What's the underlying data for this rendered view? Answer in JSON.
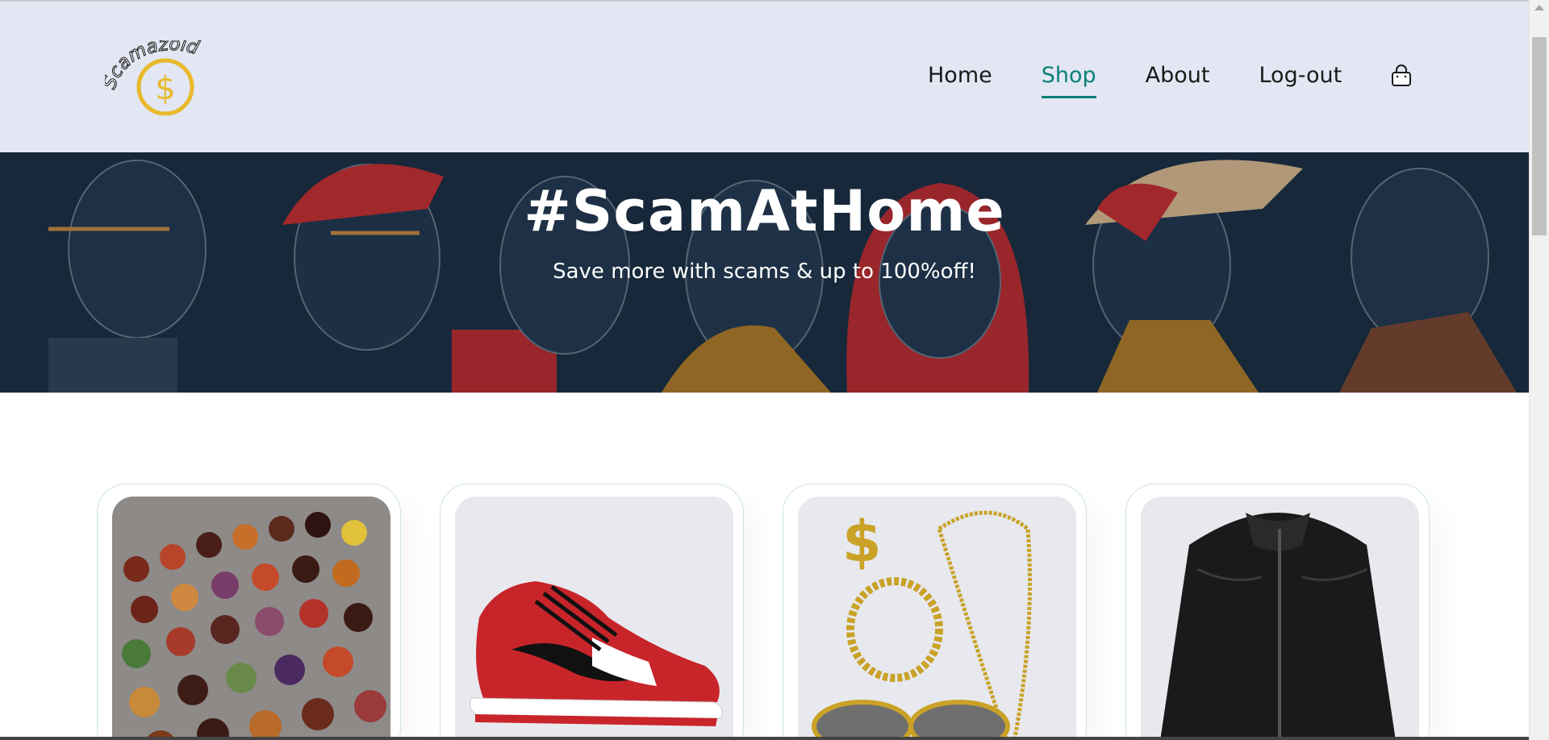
{
  "header": {
    "logo_text": "Scamazoid",
    "nav": [
      {
        "label": "Home",
        "active": false
      },
      {
        "label": "Shop",
        "active": true
      },
      {
        "label": "About",
        "active": false
      },
      {
        "label": "Log-out",
        "active": false
      }
    ],
    "cart_icon": "shopping-bag-icon"
  },
  "hero": {
    "title": "#ScamAtHome",
    "subtitle": "Save more with scams & up to 100%off!"
  },
  "products": [
    {
      "image": "chocolate-box"
    },
    {
      "image": "red-sneaker"
    },
    {
      "image": "gold-jewelry"
    },
    {
      "image": "leather-jacket"
    }
  ],
  "colors": {
    "header_bg": "#e3e6f3",
    "accent": "#088178",
    "hero_bg": "#17283a",
    "logo_gold": "#e8b92a"
  }
}
